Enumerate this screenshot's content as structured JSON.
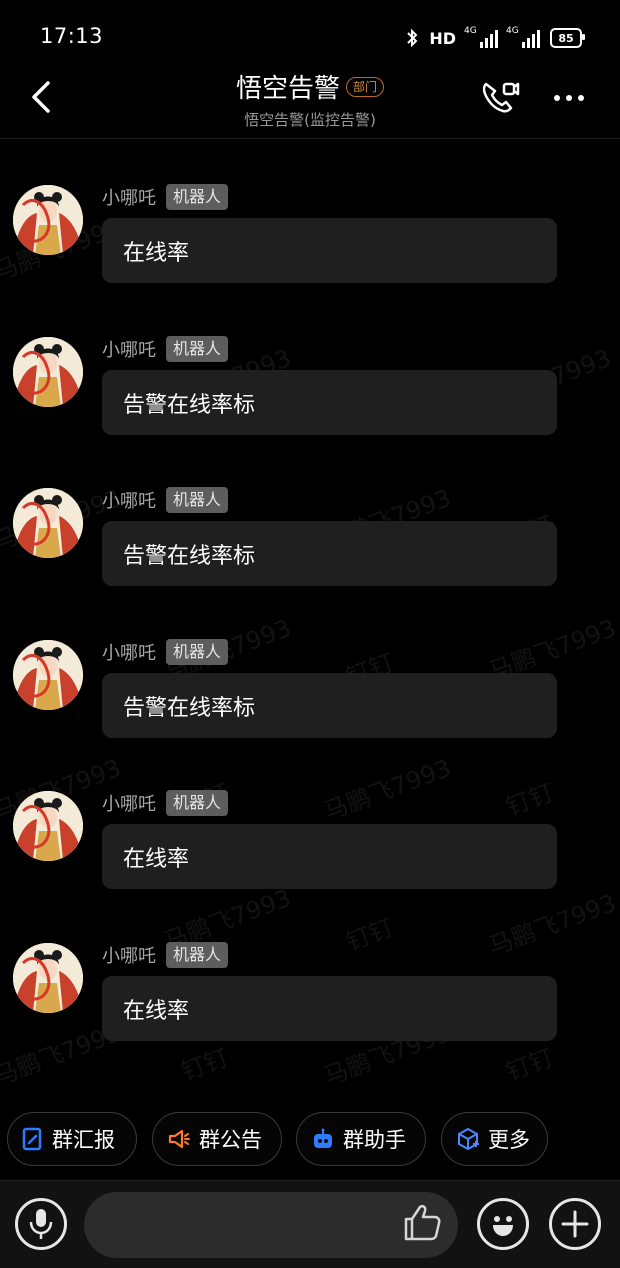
{
  "status_bar": {
    "time": "17:13",
    "network": "HD",
    "signal1_label": "4G",
    "signal2_label": "4G",
    "battery": "85"
  },
  "header": {
    "title": "悟空告警",
    "badge": "部门",
    "subtitle": "悟空告警(监控告警)"
  },
  "watermarks": [
    "马鹏飞7993",
    "钉钉"
  ],
  "messages": [
    {
      "sender": "小哪吒",
      "tag": "机器人",
      "text": "在线率"
    },
    {
      "sender": "小哪吒",
      "tag": "机器人",
      "text": "告警在线率标"
    },
    {
      "sender": "小哪吒",
      "tag": "机器人",
      "text": "告警在线率标"
    },
    {
      "sender": "小哪吒",
      "tag": "机器人",
      "text": "告警在线率标"
    },
    {
      "sender": "小哪吒",
      "tag": "机器人",
      "text": "在线率"
    },
    {
      "sender": "小哪吒",
      "tag": "机器人",
      "text": "在线率"
    }
  ],
  "quick_actions": [
    {
      "label": "群汇报",
      "icon": "report-icon",
      "color": "#2f7bff"
    },
    {
      "label": "群公告",
      "icon": "megaphone-icon",
      "color": "#ff7a2a"
    },
    {
      "label": "群助手",
      "icon": "robot-icon",
      "color": "#2f7bff"
    },
    {
      "label": "更多",
      "icon": "cube-icon",
      "color": "#4a88ff"
    }
  ],
  "input_bar": {
    "placeholder": ""
  }
}
